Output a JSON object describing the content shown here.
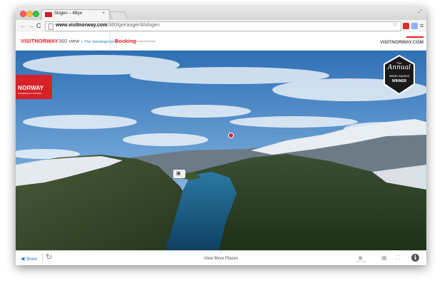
{
  "browser": {
    "tab": {
      "title": "Slogen – 4Bye",
      "close": "×"
    },
    "address_bar": {
      "url_domain": "www.visitnorway.com",
      "url_path": "/360/geiranger/#/slogen"
    },
    "icons": {
      "back": "back-arrow-icon",
      "forward": "forward-arrow-icon",
      "reload": "reload-icon",
      "star": "bookmark-star-icon",
      "menu": "hamburger-menu-icon"
    },
    "glyphs": {
      "back": "←",
      "forward": "→",
      "reload": "C",
      "star": "☆",
      "menu": "≡",
      "resize": "⤢"
    }
  },
  "site_header": {
    "logo_brand": "VISITNORWAY",
    "logo_360": "360 view",
    "logo_place": "» The Geirangerfjord",
    "booking_label": "Booking",
    "booking_by": "by BookNorway",
    "right_logo": "VISITNORWAY.COM"
  },
  "panorama": {
    "badge_title": "NORWAY",
    "badge_sub": "POWERED BY NATURE",
    "webby": {
      "the": "The",
      "annual": "Annual",
      "awards": "WEBBY AWARDS",
      "winner": "WINNER"
    },
    "cam_glyph": "▣"
  },
  "bottom_bar": {
    "share_icon": "◀",
    "share_label": "Share",
    "compass_glyph": "↻",
    "view_more_caret": "⌃",
    "view_more_label": "View More Places",
    "eye_glyph": "◉",
    "eye_label": "Auto Rotate",
    "vr_glyph": "▦",
    "expand_glyph": "⛶",
    "info_glyph": "i"
  },
  "colors": {
    "brand_red": "#e31e24",
    "link_blue": "#2a72b8",
    "fjord_blue": "#1f5f8a"
  }
}
